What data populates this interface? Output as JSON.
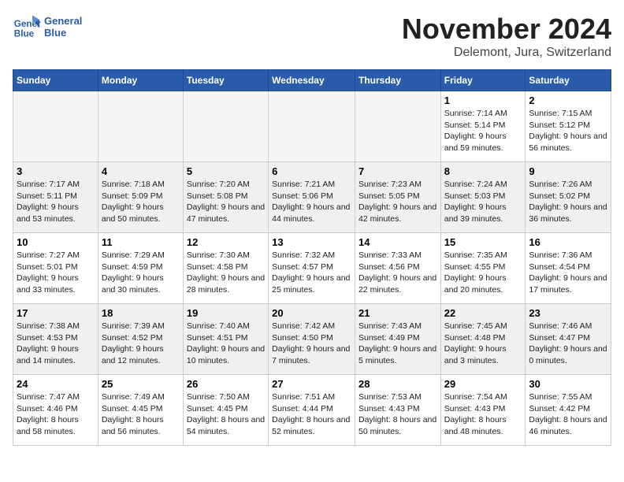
{
  "logo": {
    "line1": "General",
    "line2": "Blue"
  },
  "title": "November 2024",
  "location": "Delemont, Jura, Switzerland",
  "weekdays": [
    "Sunday",
    "Monday",
    "Tuesday",
    "Wednesday",
    "Thursday",
    "Friday",
    "Saturday"
  ],
  "weeks": [
    [
      {
        "day": "",
        "info": ""
      },
      {
        "day": "",
        "info": ""
      },
      {
        "day": "",
        "info": ""
      },
      {
        "day": "",
        "info": ""
      },
      {
        "day": "",
        "info": ""
      },
      {
        "day": "1",
        "info": "Sunrise: 7:14 AM\nSunset: 5:14 PM\nDaylight: 9 hours and 59 minutes."
      },
      {
        "day": "2",
        "info": "Sunrise: 7:15 AM\nSunset: 5:12 PM\nDaylight: 9 hours and 56 minutes."
      }
    ],
    [
      {
        "day": "3",
        "info": "Sunrise: 7:17 AM\nSunset: 5:11 PM\nDaylight: 9 hours and 53 minutes."
      },
      {
        "day": "4",
        "info": "Sunrise: 7:18 AM\nSunset: 5:09 PM\nDaylight: 9 hours and 50 minutes."
      },
      {
        "day": "5",
        "info": "Sunrise: 7:20 AM\nSunset: 5:08 PM\nDaylight: 9 hours and 47 minutes."
      },
      {
        "day": "6",
        "info": "Sunrise: 7:21 AM\nSunset: 5:06 PM\nDaylight: 9 hours and 44 minutes."
      },
      {
        "day": "7",
        "info": "Sunrise: 7:23 AM\nSunset: 5:05 PM\nDaylight: 9 hours and 42 minutes."
      },
      {
        "day": "8",
        "info": "Sunrise: 7:24 AM\nSunset: 5:03 PM\nDaylight: 9 hours and 39 minutes."
      },
      {
        "day": "9",
        "info": "Sunrise: 7:26 AM\nSunset: 5:02 PM\nDaylight: 9 hours and 36 minutes."
      }
    ],
    [
      {
        "day": "10",
        "info": "Sunrise: 7:27 AM\nSunset: 5:01 PM\nDaylight: 9 hours and 33 minutes."
      },
      {
        "day": "11",
        "info": "Sunrise: 7:29 AM\nSunset: 4:59 PM\nDaylight: 9 hours and 30 minutes."
      },
      {
        "day": "12",
        "info": "Sunrise: 7:30 AM\nSunset: 4:58 PM\nDaylight: 9 hours and 28 minutes."
      },
      {
        "day": "13",
        "info": "Sunrise: 7:32 AM\nSunset: 4:57 PM\nDaylight: 9 hours and 25 minutes."
      },
      {
        "day": "14",
        "info": "Sunrise: 7:33 AM\nSunset: 4:56 PM\nDaylight: 9 hours and 22 minutes."
      },
      {
        "day": "15",
        "info": "Sunrise: 7:35 AM\nSunset: 4:55 PM\nDaylight: 9 hours and 20 minutes."
      },
      {
        "day": "16",
        "info": "Sunrise: 7:36 AM\nSunset: 4:54 PM\nDaylight: 9 hours and 17 minutes."
      }
    ],
    [
      {
        "day": "17",
        "info": "Sunrise: 7:38 AM\nSunset: 4:53 PM\nDaylight: 9 hours and 14 minutes."
      },
      {
        "day": "18",
        "info": "Sunrise: 7:39 AM\nSunset: 4:52 PM\nDaylight: 9 hours and 12 minutes."
      },
      {
        "day": "19",
        "info": "Sunrise: 7:40 AM\nSunset: 4:51 PM\nDaylight: 9 hours and 10 minutes."
      },
      {
        "day": "20",
        "info": "Sunrise: 7:42 AM\nSunset: 4:50 PM\nDaylight: 9 hours and 7 minutes."
      },
      {
        "day": "21",
        "info": "Sunrise: 7:43 AM\nSunset: 4:49 PM\nDaylight: 9 hours and 5 minutes."
      },
      {
        "day": "22",
        "info": "Sunrise: 7:45 AM\nSunset: 4:48 PM\nDaylight: 9 hours and 3 minutes."
      },
      {
        "day": "23",
        "info": "Sunrise: 7:46 AM\nSunset: 4:47 PM\nDaylight: 9 hours and 0 minutes."
      }
    ],
    [
      {
        "day": "24",
        "info": "Sunrise: 7:47 AM\nSunset: 4:46 PM\nDaylight: 8 hours and 58 minutes."
      },
      {
        "day": "25",
        "info": "Sunrise: 7:49 AM\nSunset: 4:45 PM\nDaylight: 8 hours and 56 minutes."
      },
      {
        "day": "26",
        "info": "Sunrise: 7:50 AM\nSunset: 4:45 PM\nDaylight: 8 hours and 54 minutes."
      },
      {
        "day": "27",
        "info": "Sunrise: 7:51 AM\nSunset: 4:44 PM\nDaylight: 8 hours and 52 minutes."
      },
      {
        "day": "28",
        "info": "Sunrise: 7:53 AM\nSunset: 4:43 PM\nDaylight: 8 hours and 50 minutes."
      },
      {
        "day": "29",
        "info": "Sunrise: 7:54 AM\nSunset: 4:43 PM\nDaylight: 8 hours and 48 minutes."
      },
      {
        "day": "30",
        "info": "Sunrise: 7:55 AM\nSunset: 4:42 PM\nDaylight: 8 hours and 46 minutes."
      }
    ]
  ]
}
